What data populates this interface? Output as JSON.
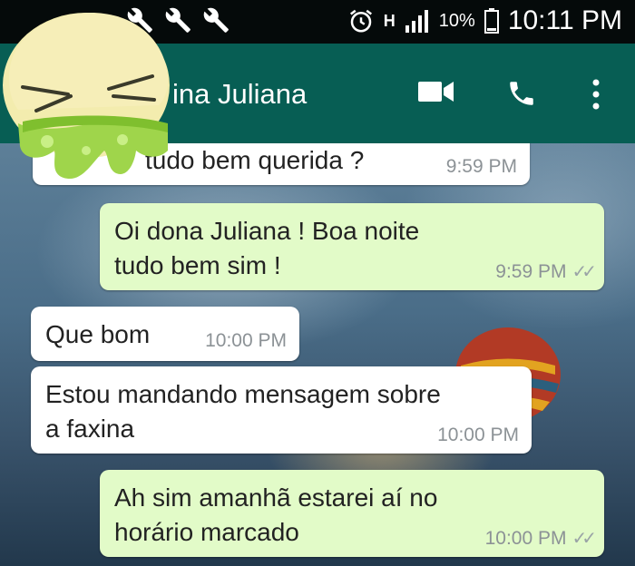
{
  "status_bar": {
    "battery": "10%",
    "time": "10:11 PM",
    "network_label": "H",
    "icons": [
      "whatsapp-icon",
      "wrench-icon",
      "wrench-icon",
      "wrench-icon",
      "alarm-icon",
      "signal-icon",
      "battery-icon"
    ]
  },
  "header": {
    "contact_name": "ina Juliana",
    "icons": [
      "video-call-icon",
      "voice-call-icon",
      "more-options-icon"
    ]
  },
  "messages": [
    {
      "direction": "in",
      "text": "tudo bem querida ?",
      "time": "9:59 PM",
      "ticks": ""
    },
    {
      "direction": "out",
      "text": "Oi dona Juliana ! Boa noite tudo bem sim !",
      "time": "9:59 PM",
      "ticks": "✓✓"
    },
    {
      "direction": "in",
      "text": "Que bom",
      "time": "10:00 PM",
      "ticks": ""
    },
    {
      "direction": "in",
      "text": "Estou mandando mensagem sobre a faxina",
      "time": "10:00 PM",
      "ticks": ""
    },
    {
      "direction": "out",
      "text": "Ah sim amanhã estarei aí no horário marcado",
      "time": "10:00 PM",
      "ticks": "✓✓"
    }
  ],
  "colors": {
    "header": "#075e54",
    "status_bar": "#050a0a",
    "incoming_bubble": "#ffffff",
    "outgoing_bubble": "#e2fbc8",
    "timestamp": "#8c9296"
  }
}
